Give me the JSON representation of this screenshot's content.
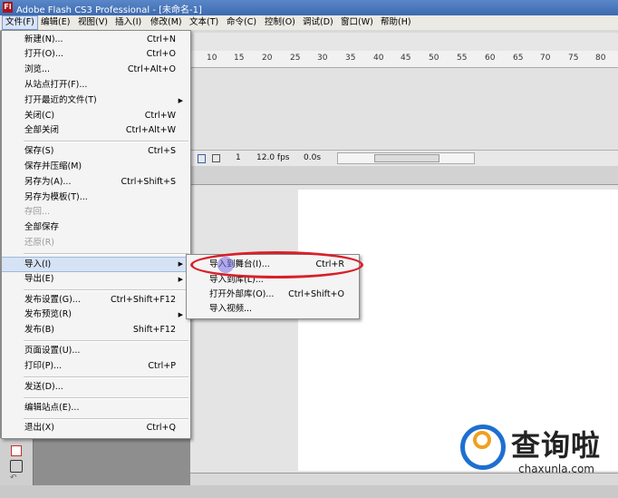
{
  "window": {
    "logo": "Fl",
    "title": "Adobe Flash CS3 Professional - [未命名-1]"
  },
  "menubar": [
    {
      "label": "文件(F)",
      "active": true
    },
    {
      "label": "编辑(E)"
    },
    {
      "label": "视图(V)"
    },
    {
      "label": "插入(I)"
    },
    {
      "label": "修改(M)"
    },
    {
      "label": "文本(T)"
    },
    {
      "label": "命令(C)"
    },
    {
      "label": "控制(O)"
    },
    {
      "label": "调试(D)"
    },
    {
      "label": "窗口(W)"
    },
    {
      "label": "帮助(H)"
    }
  ],
  "timeline": {
    "ruler": [
      "10",
      "15",
      "20",
      "25",
      "30",
      "35",
      "40",
      "45",
      "50",
      "55",
      "60",
      "65",
      "70",
      "75",
      "80"
    ],
    "frame": "1",
    "fps": "12.0 fps",
    "time": "0.0s"
  },
  "file_menu": [
    {
      "label": "新建(N)...",
      "shortcut": "Ctrl+N"
    },
    {
      "label": "打开(O)...",
      "shortcut": "Ctrl+O"
    },
    {
      "label": "浏览...",
      "shortcut": "Ctrl+Alt+O"
    },
    {
      "label": "从站点打开(F)...",
      "shortcut": ""
    },
    {
      "label": "打开最近的文件(T)",
      "shortcut": "",
      "submenu": true
    },
    {
      "label": "关闭(C)",
      "shortcut": "Ctrl+W"
    },
    {
      "label": "全部关闭",
      "shortcut": "Ctrl+Alt+W"
    },
    {
      "label": "保存(S)",
      "shortcut": "Ctrl+S"
    },
    {
      "label": "保存并压缩(M)",
      "shortcut": ""
    },
    {
      "label": "另存为(A)...",
      "shortcut": "Ctrl+Shift+S"
    },
    {
      "label": "另存为模板(T)...",
      "shortcut": ""
    },
    {
      "label": "存回...",
      "shortcut": "",
      "disabled": true
    },
    {
      "label": "全部保存",
      "shortcut": ""
    },
    {
      "label": "还原(R)",
      "shortcut": "",
      "disabled": true
    },
    {
      "label": "导入(I)",
      "shortcut": "",
      "submenu": true,
      "highlighted": true
    },
    {
      "label": "导出(E)",
      "shortcut": "",
      "submenu": true
    },
    {
      "label": "发布设置(G)...",
      "shortcut": "Ctrl+Shift+F12"
    },
    {
      "label": "发布预览(R)",
      "shortcut": "",
      "submenu": true
    },
    {
      "label": "发布(B)",
      "shortcut": "Shift+F12"
    },
    {
      "label": "页面设置(U)...",
      "shortcut": ""
    },
    {
      "label": "打印(P)...",
      "shortcut": "Ctrl+P"
    },
    {
      "label": "发送(D)...",
      "shortcut": ""
    },
    {
      "label": "编辑站点(E)...",
      "shortcut": ""
    },
    {
      "label": "退出(X)",
      "shortcut": "Ctrl+Q"
    }
  ],
  "import_submenu": [
    {
      "label": "导入到舞台(I)...",
      "shortcut": "Ctrl+R"
    },
    {
      "label": "导入到库(L)...",
      "shortcut": ""
    },
    {
      "label": "打开外部库(O)...",
      "shortcut": "Ctrl+Shift+O"
    },
    {
      "label": "导入视频...",
      "shortcut": ""
    }
  ],
  "watermark": {
    "text": "查询啦",
    "url": "chaxunla.com"
  },
  "colors": {
    "highlight_ring": "#d8202a",
    "title_bar": "#3c6ab0"
  }
}
